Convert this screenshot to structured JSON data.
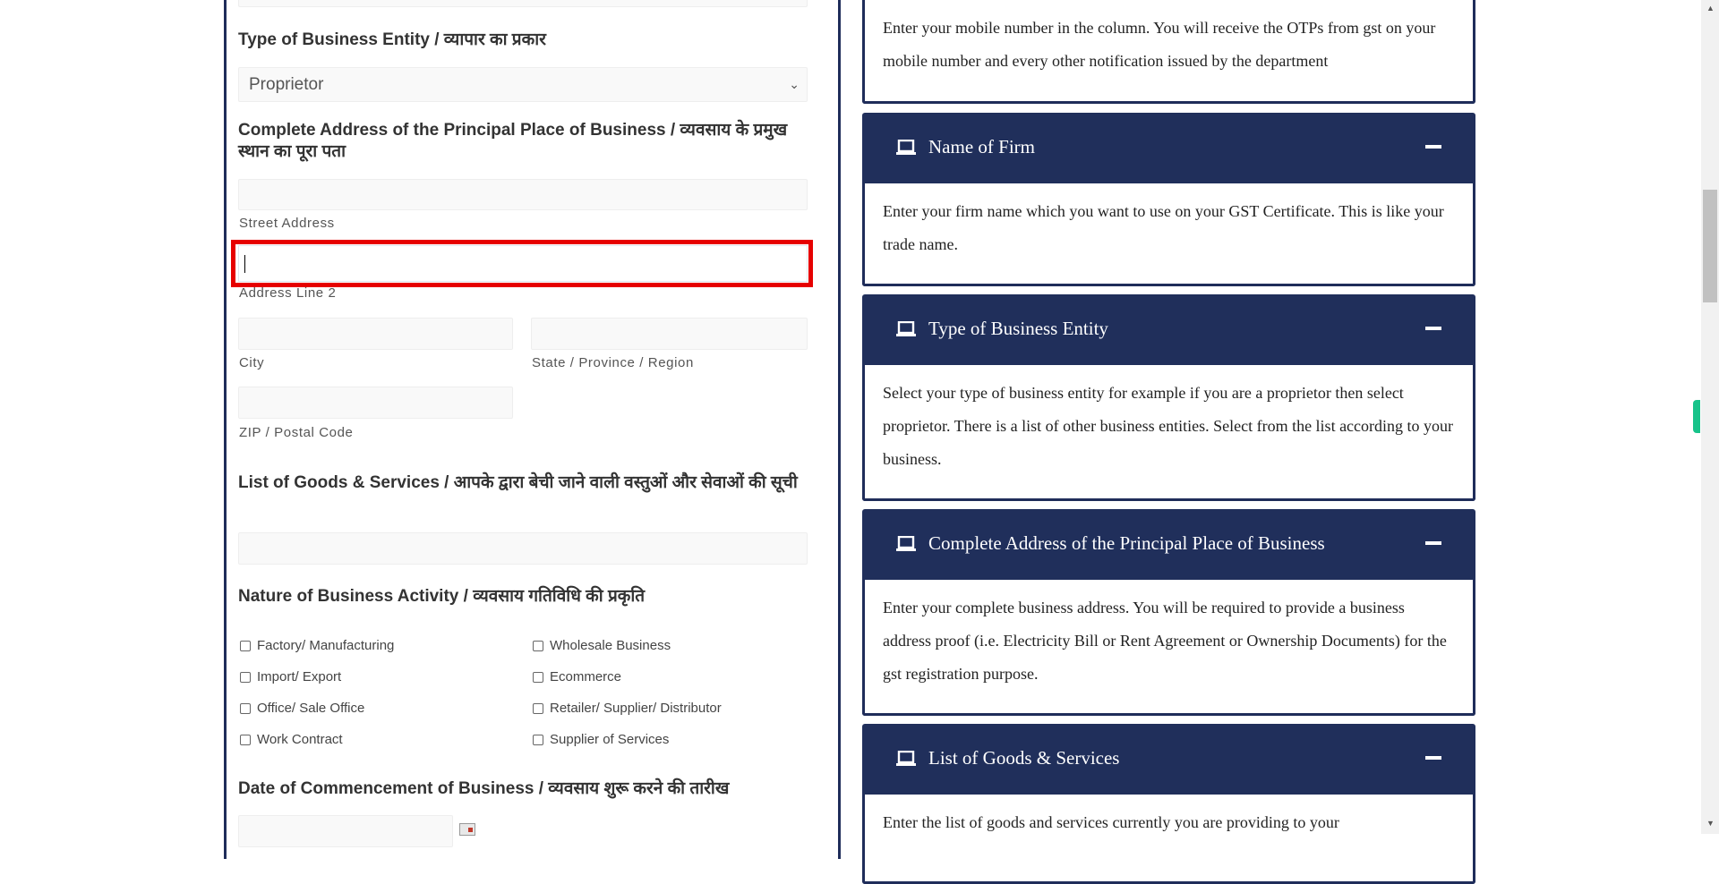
{
  "form": {
    "business_entity": {
      "heading": "Type of Business Entity / व्यापार का प्रकार",
      "selected": "Proprietor"
    },
    "address": {
      "heading": "Complete Address of the Principal Place of Business / व्यवसाय के प्रमुख स्थान का पूरा पता",
      "street_label": "Street Address",
      "street_value": "",
      "line2_label": "Address Line 2",
      "line2_value": "",
      "city_label": "City",
      "city_value": "",
      "state_label": "State / Province / Region",
      "state_value": "",
      "zip_label": "ZIP / Postal Code",
      "zip_value": ""
    },
    "goods": {
      "heading": "List of Goods & Services / आपके द्वारा बेची जाने वाली वस्तुओं और सेवाओं की सूची",
      "value": ""
    },
    "nature": {
      "heading": "Nature of Business Activity / व्यवसाय गतिविधि की प्रकृति",
      "options": [
        {
          "label": "Factory/ Manufacturing",
          "checked": false
        },
        {
          "label": "Wholesale Business",
          "checked": false
        },
        {
          "label": "Import/ Export",
          "checked": false
        },
        {
          "label": "Ecommerce",
          "checked": false
        },
        {
          "label": "Office/ Sale Office",
          "checked": false
        },
        {
          "label": "Retailer/ Supplier/ Distributor",
          "checked": false
        },
        {
          "label": "Work Contract",
          "checked": false
        },
        {
          "label": "Supplier of Services",
          "checked": false
        }
      ]
    },
    "date": {
      "heading": "Date of Commencement of Business / व्यवसाय शुरू करने की तारीख",
      "value": "",
      "icon": "calendar-icon"
    }
  },
  "help_panel": {
    "mobile_text": "Enter your mobile number in the column. You will receive the OTPs from gst on your mobile number and every other notification issued by the department",
    "sections": [
      {
        "title": "Name of Firm",
        "icon": "laptop-icon",
        "toggle": "minus-icon",
        "text": "Enter your firm name which you want to use on your GST Certificate. This is like your trade name."
      },
      {
        "title": "Type of Business Entity",
        "icon": "laptop-icon",
        "toggle": "minus-icon",
        "text": "Select your type of business entity for example if you are a proprietor then select proprietor. There is a list of other business entities. Select from the list according to your business."
      },
      {
        "title": "Complete Address of the Principal Place of Business",
        "icon": "laptop-icon",
        "toggle": "minus-icon",
        "text": "Enter your complete business address. You will be required to provide a business address proof (i.e. Electricity Bill or Rent Agreement or Ownership Documents) for the gst registration purpose."
      },
      {
        "title": "List of Goods & Services",
        "icon": "laptop-icon",
        "toggle": "minus-icon",
        "text": "Enter the list of goods and services currently you are providing to your"
      }
    ]
  },
  "colors": {
    "header_navy": "#202f5b",
    "highlight_red": "#e60000",
    "accent_green": "#18c38a"
  }
}
